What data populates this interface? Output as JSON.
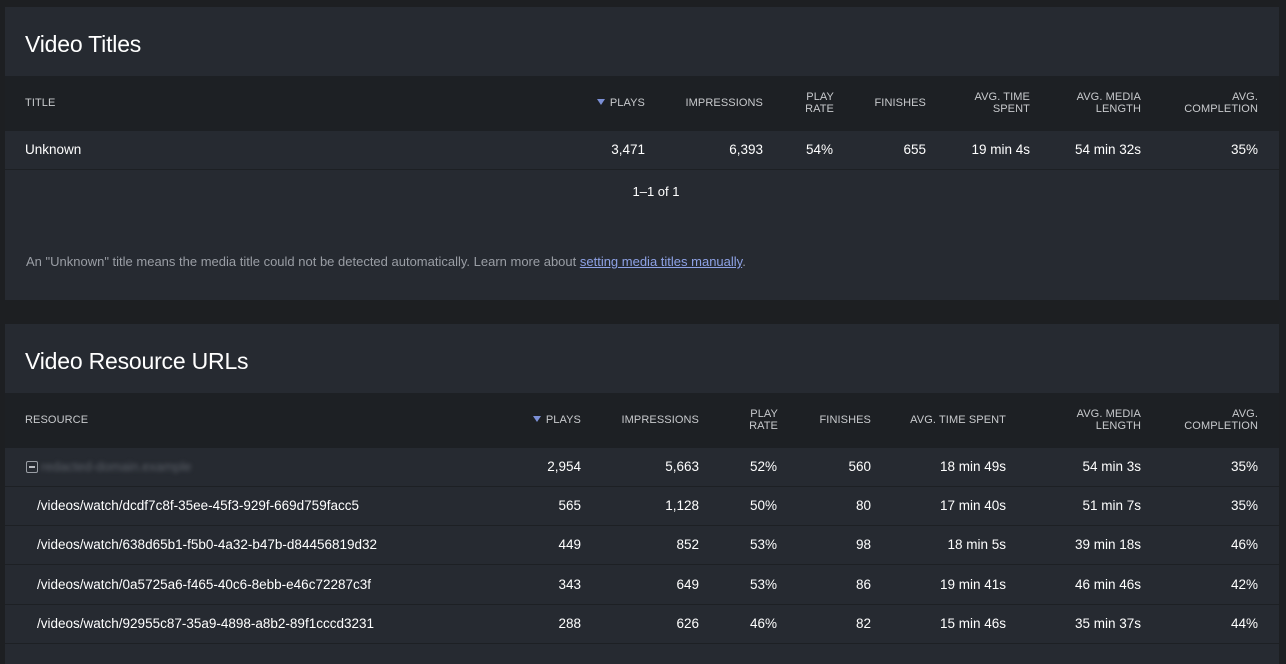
{
  "titles_panel": {
    "heading": "Video Titles",
    "columns": {
      "title": "Title",
      "plays": "Plays",
      "impressions": "Impressions",
      "play_rate": "Play Rate",
      "finishes": "Finishes",
      "avg_time_spent": "Avg. Time Spent",
      "avg_media_length": "Avg. Media Length",
      "avg_completion": "Avg. Completion"
    },
    "sort": {
      "column": "plays",
      "direction": "descending"
    },
    "rows": [
      {
        "title": "Unknown",
        "plays": "3,471",
        "impressions": "6,393",
        "play_rate": "54%",
        "finishes": "655",
        "avg_time_spent": "19 min 4s",
        "avg_media_length": "54 min 32s",
        "avg_completion": "35%"
      }
    ],
    "pagination": "1–1 of 1",
    "note_text": "An \"Unknown\" title means the media title could not be detected automatically. Learn more about ",
    "note_link": "setting media titles manually",
    "note_end": "."
  },
  "urls_panel": {
    "heading": "Video Resource URLs",
    "columns": {
      "resource": "Resource",
      "plays": "Plays",
      "impressions": "Impressions",
      "play_rate": "Play Rate",
      "finishes": "Finishes",
      "avg_time_spent": "Avg. Time Spent",
      "avg_media_length": "Avg. Media Length",
      "avg_completion": "Avg. Completion"
    },
    "sort": {
      "column": "plays",
      "direction": "descending"
    },
    "group_row": {
      "resource": "redacted-domain.example",
      "plays": "2,954",
      "impressions": "5,663",
      "play_rate": "52%",
      "finishes": "560",
      "avg_time_spent": "18 min 49s",
      "avg_media_length": "54 min 3s",
      "avg_completion": "35%",
      "expanded": true
    },
    "rows": [
      {
        "resource": "/videos/watch/dcdf7c8f-35ee-45f3-929f-669d759facc5",
        "plays": "565",
        "impressions": "1,128",
        "play_rate": "50%",
        "finishes": "80",
        "avg_time_spent": "17 min 40s",
        "avg_media_length": "51 min 7s",
        "avg_completion": "35%"
      },
      {
        "resource": "/videos/watch/638d65b1-f5b0-4a32-b47b-d84456819d32",
        "plays": "449",
        "impressions": "852",
        "play_rate": "53%",
        "finishes": "98",
        "avg_time_spent": "18 min 5s",
        "avg_media_length": "39 min 18s",
        "avg_completion": "46%"
      },
      {
        "resource": "/videos/watch/0a5725a6-f465-40c6-8ebb-e46c72287c3f",
        "plays": "343",
        "impressions": "649",
        "play_rate": "53%",
        "finishes": "86",
        "avg_time_spent": "19 min 41s",
        "avg_media_length": "46 min 46s",
        "avg_completion": "42%"
      },
      {
        "resource": "/videos/watch/92955c87-35a9-4898-a8b2-89f1cccd3231",
        "plays": "288",
        "impressions": "626",
        "play_rate": "46%",
        "finishes": "82",
        "avg_time_spent": "15 min 46s",
        "avg_media_length": "35 min 37s",
        "avg_completion": "44%"
      }
    ]
  },
  "colors": {
    "accent": "#7b8fd6",
    "link": "#8ea2e6",
    "panel_bg": "#262a31",
    "header_bg": "#1d2024",
    "page_bg": "#1d1f22"
  }
}
